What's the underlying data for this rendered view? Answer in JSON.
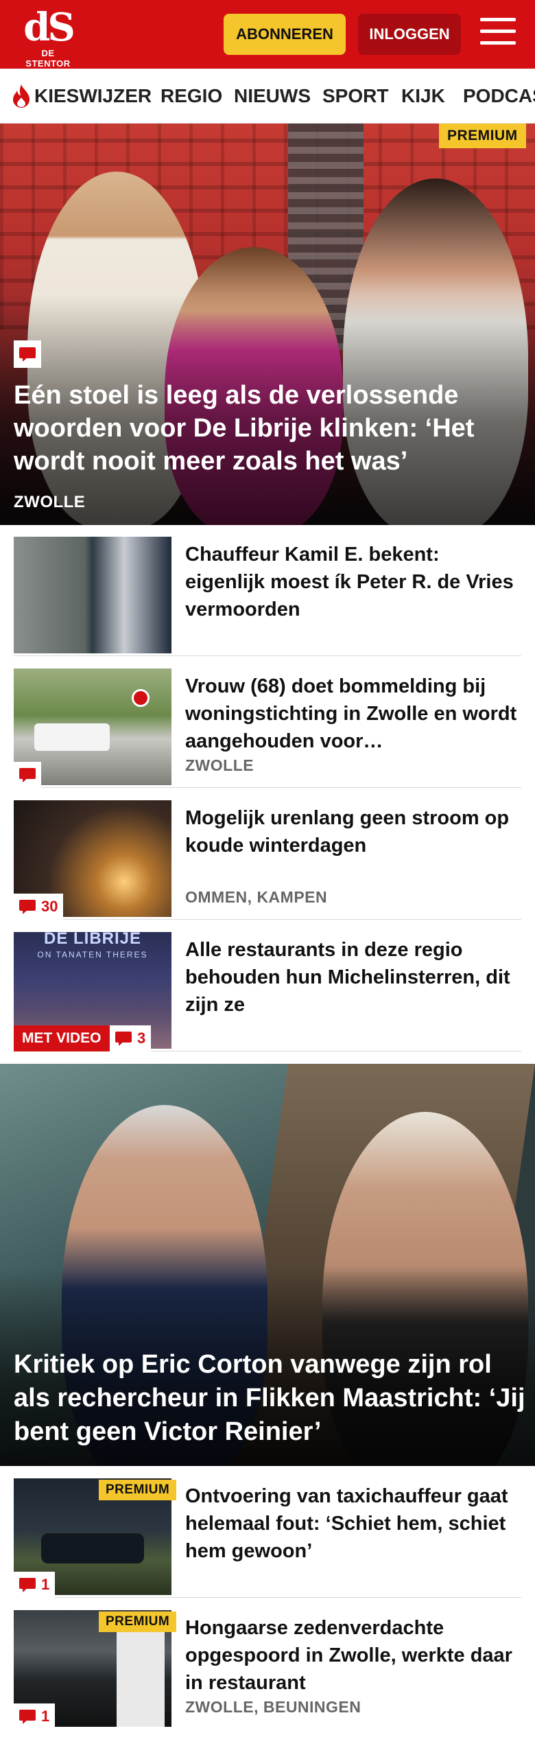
{
  "header": {
    "logo_mark": "dS",
    "logo_sub": "DE STENTOR",
    "subscribe_label": "ABONNEREN",
    "login_label": "INLOGGEN",
    "brand_color": "#d40f14",
    "accent_color": "#f5c62b"
  },
  "nav": {
    "items": [
      "KIESWIJZER",
      "REGIO",
      "NIEUWS",
      "SPORT",
      "KIJK",
      "PODCAST"
    ]
  },
  "hero": {
    "premium_label": "PREMIUM",
    "title": "Eén stoel is leeg als de verlossende woorden voor De Librije klinken: ‘Het wordt nooit meer zoals het was’",
    "location": "ZWOLLE"
  },
  "articles": [
    {
      "title": "Chauffeur Kamil E. bekent: eigenlijk moest ík Peter R. de Vries vermoorden",
      "location": ""
    },
    {
      "title": "Vrouw (68) doet bommelding bij woningstichting in Zwolle en wordt aangehouden voor…",
      "location": "ZWOLLE"
    },
    {
      "title": "Mogelijk urenlang geen stroom op koude winterdagen",
      "location": "OMMEN, KAMPEN",
      "comments": "30"
    },
    {
      "title": "Alle restaurants in deze regio behouden hun Michelinsterren, dit zijn ze",
      "location": "",
      "video_label": "MET VIDEO",
      "comments": "3",
      "thumb_caption": "DE LIBRIJE",
      "thumb_subcaption": "ON TANATEN  THERES"
    }
  ],
  "feature": {
    "title": "Kritiek op Eric Corton vanwege zijn rol als rechercheur in Flikken Maastricht: ‘Jij bent geen Victor Reinier’"
  },
  "articles2": [
    {
      "title": "Ontvoering van taxichauffeur gaat helemaal fout: ‘Schiet hem, schiet hem gewoon’",
      "premium_label": "PREMIUM",
      "comments": "1"
    },
    {
      "title": "Hongaarse zedenverdachte opgespoord in Zwolle, werkte daar in restaurant",
      "location": "ZWOLLE, BEUNINGEN",
      "premium_label": "PREMIUM",
      "comments": "1"
    }
  ]
}
